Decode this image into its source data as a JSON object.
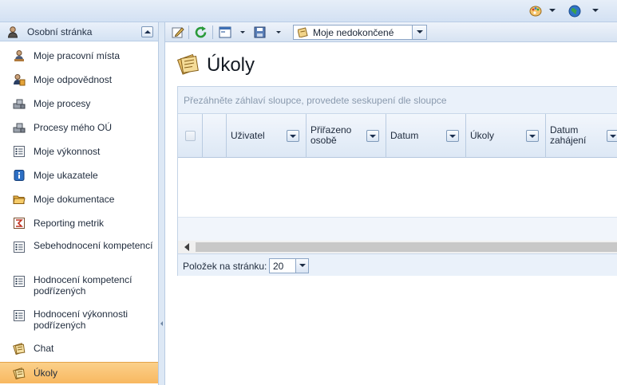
{
  "topbar": {
    "icons": [
      "palette-icon",
      "globe-icon"
    ]
  },
  "sidebar": {
    "header": {
      "title": "Osobní stránka",
      "icon": "person-icon"
    },
    "items": [
      {
        "label": "Moje pracovní místa",
        "icon": "person-desk-icon"
      },
      {
        "label": "Moje odpovědnost",
        "icon": "person-role-icon"
      },
      {
        "label": "Moje procesy",
        "icon": "process-icon"
      },
      {
        "label": "Procesy mého OÚ",
        "icon": "process-icon"
      },
      {
        "label": "Moje výkonnost",
        "icon": "checklist-icon"
      },
      {
        "label": "Moje ukazatele",
        "icon": "indicator-icon"
      },
      {
        "label": "Moje dokumentace",
        "icon": "folder-icon"
      },
      {
        "label": "Reporting metrik",
        "icon": "report-icon"
      },
      {
        "label": "Sebehodnocení kompetencí",
        "icon": "checklist-icon"
      },
      {
        "label": "Hodnocení kompetencí podřízených",
        "icon": "checklist-icon"
      },
      {
        "label": "Hodnocení výkonnosti podřízených",
        "icon": "checklist-icon"
      },
      {
        "label": "Chat",
        "icon": "notes-icon"
      },
      {
        "label": "Úkoly",
        "icon": "notes-icon",
        "active": true
      }
    ]
  },
  "toolbar": {
    "buttons": [
      "edit-icon",
      "refresh-icon",
      "layout-icon",
      "save-icon"
    ],
    "filter": {
      "value": "Moje nedokončené"
    }
  },
  "main": {
    "title": "Úkoly",
    "grid": {
      "group_hint": "Přezáhněte záhlaví sloupce, provedete seskupení dle sloupce",
      "columns": [
        "Uživatel",
        "Přiřazeno osobě",
        "Datum",
        "Úkoly",
        "Datum zahájení"
      ],
      "rows": []
    },
    "pager": {
      "label": "Položek na stránku:",
      "page_size": "20"
    }
  },
  "colors": {
    "accent": "#f8b860",
    "header_bg": "#d4e2f3",
    "border": "#b8cbe2"
  }
}
